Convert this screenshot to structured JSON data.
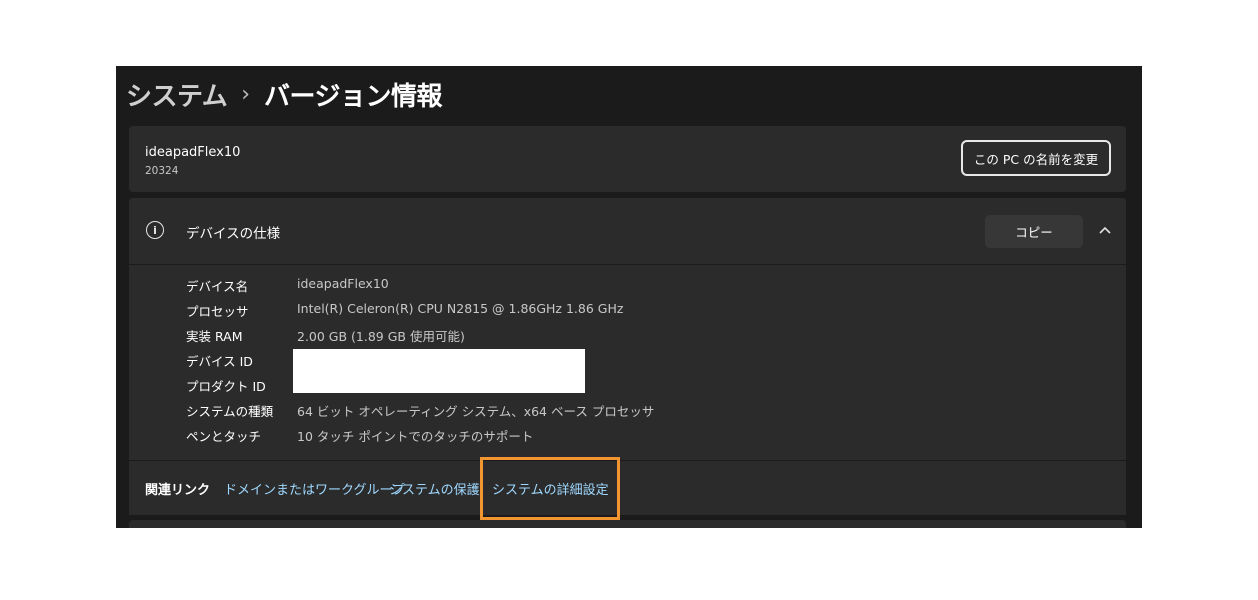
{
  "breadcrumb": {
    "parent": "システム",
    "separator": "›",
    "current": "バージョン情報"
  },
  "device": {
    "name": "ideapadFlex10",
    "model": "20324",
    "rename_button": "この PC の名前を変更"
  },
  "specs": {
    "title": "デバイスの仕様",
    "copy_button": "コピー",
    "rows": [
      {
        "label": "デバイス名",
        "value": "ideapadFlex10"
      },
      {
        "label": "プロセッサ",
        "value": "Intel(R) Celeron(R) CPU  N2815  @ 1.86GHz   1.86 GHz"
      },
      {
        "label": "実装 RAM",
        "value": "2.00 GB (1.89 GB 使用可能)"
      },
      {
        "label": "デバイス ID",
        "value": ""
      },
      {
        "label": "プロダクト ID",
        "value": ""
      },
      {
        "label": "システムの種類",
        "value": "64 ビット オペレーティング システム、x64 ベース プロセッサ"
      },
      {
        "label": "ペンとタッチ",
        "value": "10 タッチ ポイントでのタッチのサポート"
      }
    ]
  },
  "related": {
    "title": "関連リンク",
    "links": [
      "ドメインまたはワークグループ",
      "システムの保護",
      "システムの詳細設定"
    ]
  },
  "colors": {
    "background": "#1b1b1b",
    "card": "#2b2b2b",
    "link": "#9fd8ff",
    "highlight": "#f39530"
  }
}
